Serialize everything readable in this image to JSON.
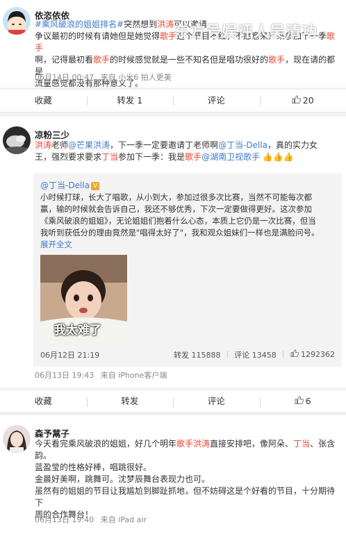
{
  "post1": {
    "name": "依恣依依",
    "line1_tag": "#乘风破浪的姐姐排名#",
    "line1_text": "突然想到",
    "line1_name": "洪涛",
    "line1_rest": "可以邀请",
    "line2_a": "争议最初的时候有请她但是她觉得",
    "line2_b": "歌手",
    "line2_c": "这个节目不红，不愿意来）来参加下一季",
    "line2_d": "歌手",
    "line3_a": "啊，记得最初看",
    "line3_b": "歌手",
    "line3_c": "的时候感觉就是一些不知名但是唱功很好的",
    "line3_d": "歌手",
    "line3_e": "，现在请的都是",
    "line4": "流量感觉都没有那种意义了。",
    "date": "06月14日 00:47",
    "source": "来自 小米6 拍人更美"
  },
  "bar1": {
    "collect": "收藏",
    "forward": "转发 1",
    "comment": "评论",
    "like": "20"
  },
  "post2": {
    "name": "凉粉三少",
    "t1": "洪涛",
    "t2": "老师",
    "t3": "@芒果洪涛",
    "t4": "，下一季一定要邀请丁老师啊",
    "t5": "@丁当-Della",
    "t6": "，真的实力女",
    "t7": "王，强烈要求要求",
    "t8": "丁当",
    "t9": "参加下一季：我是",
    "t10": "歌手",
    "t11": "@湖南卫视歌手",
    "hands": "👍👍👍",
    "date": "06月13日 19:43",
    "source": "来自 iPhone客户端"
  },
  "quote": {
    "name": "@丁当-Della",
    "badge": "V",
    "l1": "小时候打球，长大了唱歌，从小到大，参加过很多次比赛，当然不可能每次都",
    "l2": "赢，输的时候就会告诉自己，我还不够优秀，下次一定要做得更好。这次参加",
    "l3": "《乘风破浪的姐姐》，无论姐姐们抱着什么心态，本质上它仍是一次比赛，但当",
    "l4": "我听到获低分的理由竟然是\"唱得太好了\"，我和观众姐妹们一样也是满脸问号。",
    "more": "展开全文",
    "img_caption": "我太难了",
    "date": "06月12日 21:19",
    "forward": "转发 115888",
    "comment": "评论 13458",
    "like": "1292362"
  },
  "bar2": {
    "collect": "收藏",
    "forward": "转发",
    "comment": "评论",
    "like": "6"
  },
  "post3": {
    "name": "森予蒚子",
    "l1_a": "今天看完乘风破浪的姐姐，好几个明年",
    "l1_b": "歌手洪涛",
    "l1_c": "直接安排吧，像阿朵、",
    "l1_d": "丁当",
    "l1_e": "、张含",
    "l2": "韵。",
    "l3": "蓝盈莹的性格好棒，唱跳很好。",
    "l4": "金晨好美啊，跳舞可。沈梦辰舞台表现力也可。",
    "l5": "虽然有的姐姐的节目让我尴尬到脚趾抓地，但不妨碍这是个好看的节目，十分期待下",
    "l6": "周的合作舞台！",
    "date": "06月13日 19:40",
    "source": "来自 iPad air"
  },
  "watermark": "东方号娱评人吴清功",
  "colors": {
    "link": "#3e7ac8",
    "highlight": "#e8412e",
    "badge": "#f2a531"
  },
  "icons": [
    "thumbs-up-icon",
    "verified-badge-icon"
  ]
}
